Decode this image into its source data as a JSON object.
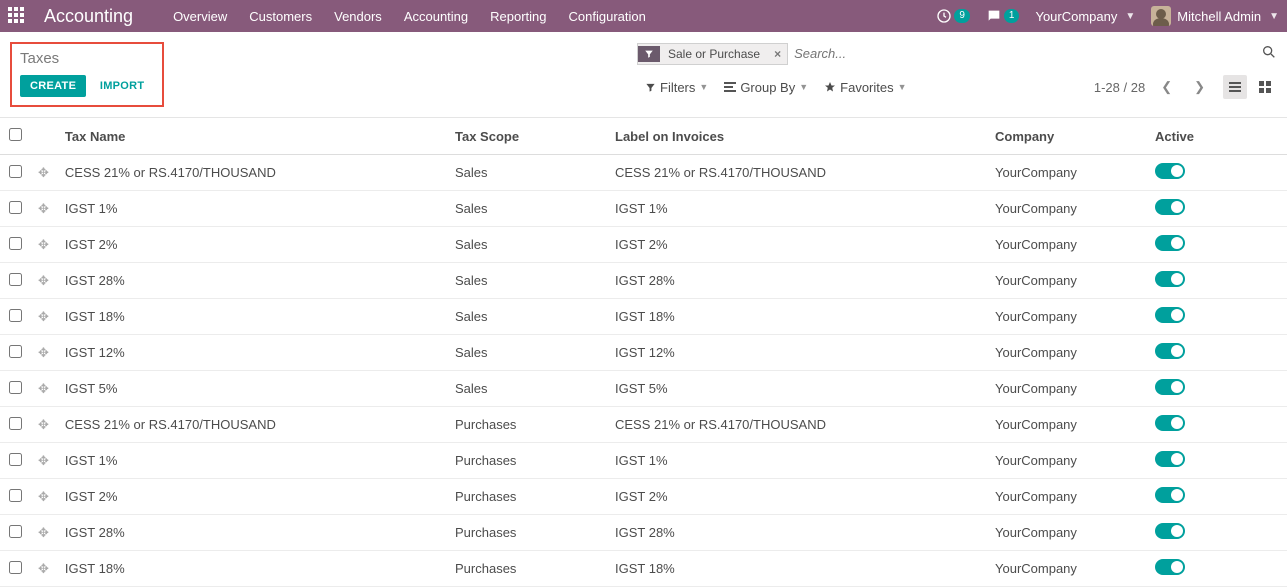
{
  "navbar": {
    "brand": "Accounting",
    "menu": [
      "Overview",
      "Customers",
      "Vendors",
      "Accounting",
      "Reporting",
      "Configuration"
    ],
    "activity_count": "9",
    "discuss_count": "1",
    "company": "YourCompany",
    "user": "Mitchell Admin"
  },
  "control": {
    "breadcrumb": "Taxes",
    "create": "CREATE",
    "import": "IMPORT"
  },
  "search": {
    "facet_label": "Sale or Purchase",
    "placeholder": "Search...",
    "filters": "Filters",
    "groupby": "Group By",
    "favorites": "Favorites",
    "pager": "1-28 / 28"
  },
  "columns": {
    "name": "Tax Name",
    "scope": "Tax Scope",
    "label": "Label on Invoices",
    "company": "Company",
    "active": "Active"
  },
  "rows": [
    {
      "name": "CESS 21% or RS.4170/THOUSAND",
      "scope": "Sales",
      "label": "CESS 21% or RS.4170/THOUSAND",
      "company": "YourCompany",
      "active": true
    },
    {
      "name": "IGST 1%",
      "scope": "Sales",
      "label": "IGST 1%",
      "company": "YourCompany",
      "active": true
    },
    {
      "name": "IGST 2%",
      "scope": "Sales",
      "label": "IGST 2%",
      "company": "YourCompany",
      "active": true
    },
    {
      "name": "IGST 28%",
      "scope": "Sales",
      "label": "IGST 28%",
      "company": "YourCompany",
      "active": true
    },
    {
      "name": "IGST 18%",
      "scope": "Sales",
      "label": "IGST 18%",
      "company": "YourCompany",
      "active": true
    },
    {
      "name": "IGST 12%",
      "scope": "Sales",
      "label": "IGST 12%",
      "company": "YourCompany",
      "active": true
    },
    {
      "name": "IGST 5%",
      "scope": "Sales",
      "label": "IGST 5%",
      "company": "YourCompany",
      "active": true
    },
    {
      "name": "CESS 21% or RS.4170/THOUSAND",
      "scope": "Purchases",
      "label": "CESS 21% or RS.4170/THOUSAND",
      "company": "YourCompany",
      "active": true
    },
    {
      "name": "IGST 1%",
      "scope": "Purchases",
      "label": "IGST 1%",
      "company": "YourCompany",
      "active": true
    },
    {
      "name": "IGST 2%",
      "scope": "Purchases",
      "label": "IGST 2%",
      "company": "YourCompany",
      "active": true
    },
    {
      "name": "IGST 28%",
      "scope": "Purchases",
      "label": "IGST 28%",
      "company": "YourCompany",
      "active": true
    },
    {
      "name": "IGST 18%",
      "scope": "Purchases",
      "label": "IGST 18%",
      "company": "YourCompany",
      "active": true
    }
  ]
}
